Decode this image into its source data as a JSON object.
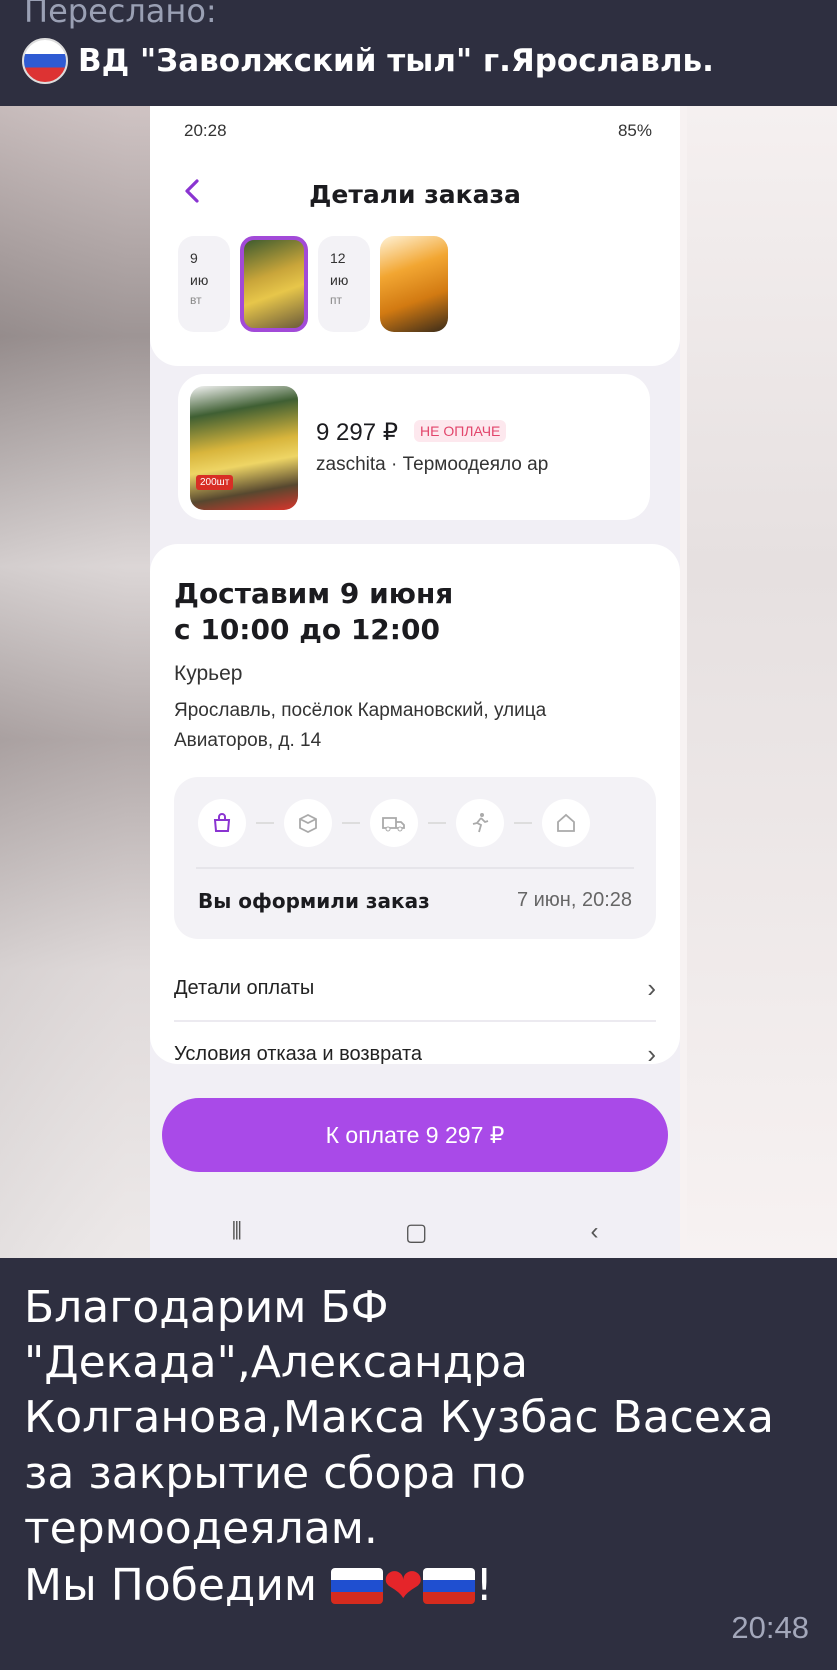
{
  "forward": {
    "label": "Переслано:",
    "source_name": "ВД \"Заволжский тыл\" г.Ярославль."
  },
  "screenshot": {
    "status_time": "20:28",
    "status_battery": "85%",
    "page_title": "Детали заказа",
    "dates": [
      {
        "day": "9",
        "month": "ию",
        "weekday": "вт"
      },
      {
        "day": "12",
        "month": "ию",
        "weekday": "пт"
      }
    ],
    "item": {
      "price": "9 297 ₽",
      "payment_badge": "НЕ ОПЛАЧЕ",
      "seller_line": "zaschita · Термоодеяло ар",
      "image_tag": "200шт"
    },
    "delivery": {
      "title_line1": "Доставим 9 июня",
      "title_line2": "с 10:00 до 12:00",
      "method": "Курьер",
      "address": "Ярославль, посёлок Кармановский, улица Авиаторов, д. 14"
    },
    "progress": {
      "status": "Вы оформили заказ",
      "time": "7 июн, 20:28"
    },
    "rows": [
      {
        "label": "Детали оплаты"
      },
      {
        "label": "Условия отказа и возврата"
      }
    ],
    "pay_button": "К оплате 9 297 ₽"
  },
  "message": {
    "text": "Благодарим БФ\n\"Декада\",Александра\nКолганова,Макса Кузбас Васеха\nза закрытие сбора по\nтермоодеялам.",
    "last_line_prefix": "Мы Победим ",
    "last_line_suffix": "!",
    "time": "20:48"
  },
  "colors": {
    "accent": "#a94ae8",
    "chat_bg": "#2e2f40",
    "unpaid": "#e2456b"
  },
  "icons": [
    "back-chevron-icon",
    "bag-icon",
    "box-icon",
    "truck-icon",
    "runner-icon",
    "home-icon",
    "chevron-right-icon",
    "russian-flag-icon",
    "heart-icon"
  ]
}
